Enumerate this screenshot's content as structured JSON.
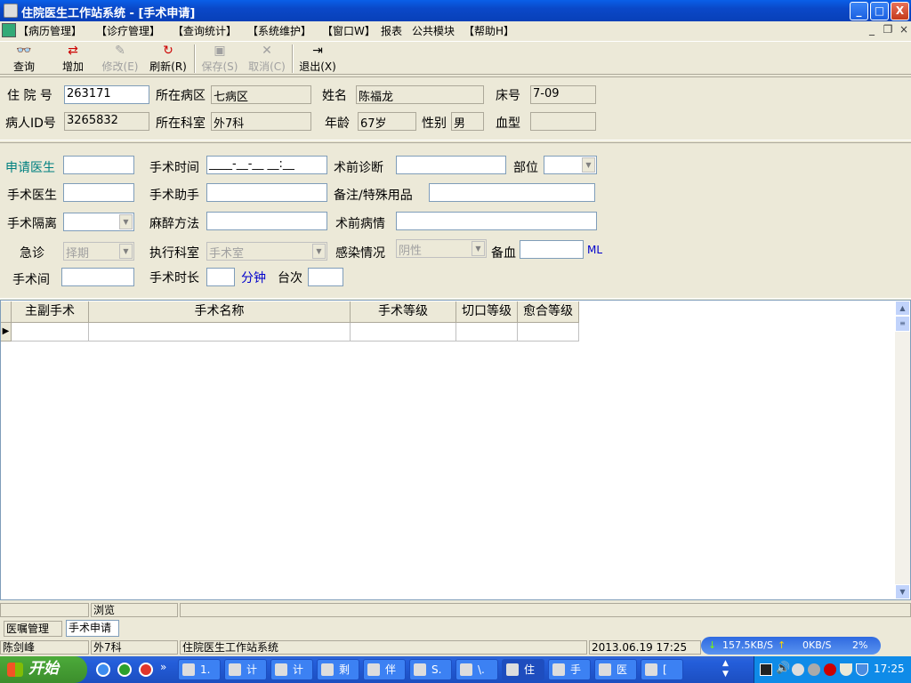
{
  "window": {
    "title": "住院医生工作站系统 - [手术申请]",
    "min": "_",
    "max": "□",
    "close": "X"
  },
  "menu": {
    "items": [
      "【病历管理】",
      "【诊疗管理】",
      "【查询统计】",
      "【系统维护】",
      "【窗口W】",
      "报表",
      "公共模块",
      "【帮助H】"
    ],
    "mdi_min": "_",
    "mdi_restore": "❐",
    "mdi_close": "×"
  },
  "toolbar": {
    "query": "查询",
    "add": "增加",
    "edit": "修改(E)",
    "refresh": "刷新(R)",
    "save": "保存(S)",
    "cancel": "取消(C)",
    "exit": "退出(X)"
  },
  "patient": {
    "admission_no_label": "住 院 号",
    "admission_no": "263171",
    "ward_label": "所在病区",
    "ward": "七病区",
    "name_label": "姓名",
    "name": "陈福龙",
    "bed_label": "床号",
    "bed": "7-09",
    "pid_label": "病人ID号",
    "pid": "3265832",
    "dept_label": "所在科室",
    "dept": "外7科",
    "age_label": "年龄",
    "age": "67岁",
    "sex_label": "性别",
    "sex": "男",
    "blood_label": "血型",
    "blood": ""
  },
  "form": {
    "applicant_label": "申请医生",
    "applicant": "",
    "op_time_label": "手术时间",
    "op_time": "____-__-__ __:__",
    "pre_diag_label": "术前诊断",
    "pre_diag": "",
    "site_label": "部位",
    "site": "",
    "surgeon_label": "手术医生",
    "surgeon": "",
    "assistant_label": "手术助手",
    "assistant": "",
    "remark_label": "备注/特殊用品",
    "remark": "",
    "isolation_label": "手术隔离",
    "isolation": "",
    "anesthesia_label": "麻醉方法",
    "anesthesia": "",
    "pre_condition_label": "术前病情",
    "pre_condition": "",
    "emergency_label": "急诊",
    "emergency": "择期",
    "exec_dept_label": "执行科室",
    "exec_dept": "手术室",
    "infection_label": "感染情况",
    "infection": "阴性",
    "blood_prep_label": "备血",
    "blood_prep": "",
    "blood_unit": "ML",
    "room_label": "手术间",
    "room": "",
    "duration_label": "手术时长",
    "duration": "",
    "duration_unit": "分钟",
    "table_no_label": "台次",
    "table_no": ""
  },
  "grid": {
    "columns": [
      "主副手术",
      "手术名称",
      "手术等级",
      "切口等级",
      "愈合等级"
    ],
    "row_marker": "▶"
  },
  "status": {
    "browse": "浏览",
    "tab_orders": "医嘱管理",
    "tab_surgery": "手术申请",
    "user": "陈剑峰",
    "dept": "外7科",
    "system": "住院医生工作站系统",
    "datetime": "2013.06.19 17:25"
  },
  "netmon": {
    "down": "157.5KB/S",
    "up": "0KB/S",
    "cpu": "2%"
  },
  "taskbar": {
    "start": "开始",
    "tasks": [
      "1.",
      "计",
      "计",
      "剩",
      "伴",
      "S.",
      "\\.",
      "住",
      "手",
      "医",
      "["
    ],
    "clock": "17:25"
  },
  "colors": {
    "titlebar": "#0A48C8",
    "face": "#ECE9D8",
    "accent_teal": "#008080",
    "accent_blue": "#0000CC"
  }
}
